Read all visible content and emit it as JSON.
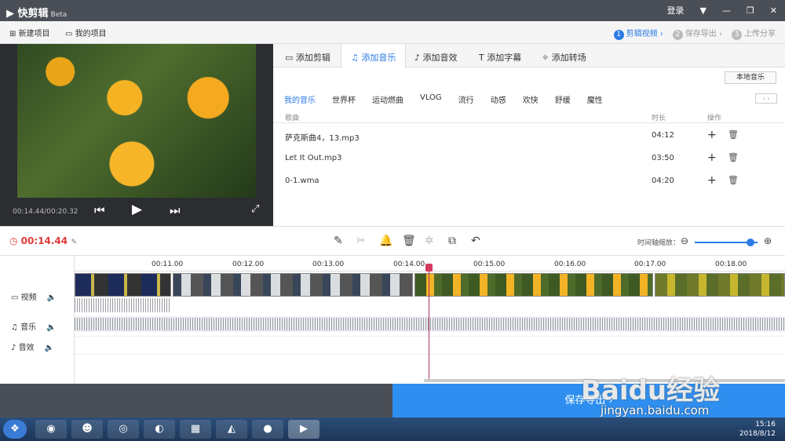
{
  "app": {
    "title": "快剪辑",
    "beta": "Beta",
    "login": "登录"
  },
  "projbar": {
    "new_project": "新建项目",
    "my_projects": "我的项目"
  },
  "steps": [
    {
      "num": "1",
      "label": "剪辑视频",
      "active": true
    },
    {
      "num": "2",
      "label": "保存导出",
      "active": false
    },
    {
      "num": "3",
      "label": "上传分享",
      "active": false
    }
  ],
  "preview": {
    "time": "00:14.44/00:20.32"
  },
  "tabs": [
    "添加剪辑",
    "添加音乐",
    "添加音效",
    "添加字幕",
    "添加转场"
  ],
  "local_music": "本地音乐",
  "categories": [
    "我的音乐",
    "世界杯",
    "运动燃曲",
    "VLOG",
    "流行",
    "动感",
    "欢快",
    "舒缓",
    "魔性"
  ],
  "table": {
    "headers": {
      "name": "歌曲",
      "duration": "时长",
      "action": "操作"
    },
    "rows": [
      {
        "name": "萨克斯曲4，13.mp3",
        "duration": "04:12"
      },
      {
        "name": "Let It Out.mp3",
        "duration": "03:50"
      },
      {
        "name": "0-1.wma",
        "duration": "04:20"
      }
    ]
  },
  "toolbar": {
    "timecode": "00:14.44",
    "zoom_label": "时间轴缩放："
  },
  "ruler": [
    "00:11.00",
    "00:12.00",
    "00:13.00",
    "00:14.00",
    "00:15.00",
    "00:16.00",
    "00:17.00",
    "00:18.00"
  ],
  "tracks": {
    "video": "视频",
    "music": "音乐",
    "sfx": "音效"
  },
  "save_export": "保存导出",
  "clock": {
    "time": "15:16",
    "date": "2018/8/12"
  },
  "watermark": {
    "logo": "Baidu经验",
    "url": "jingyan.baidu.com"
  }
}
